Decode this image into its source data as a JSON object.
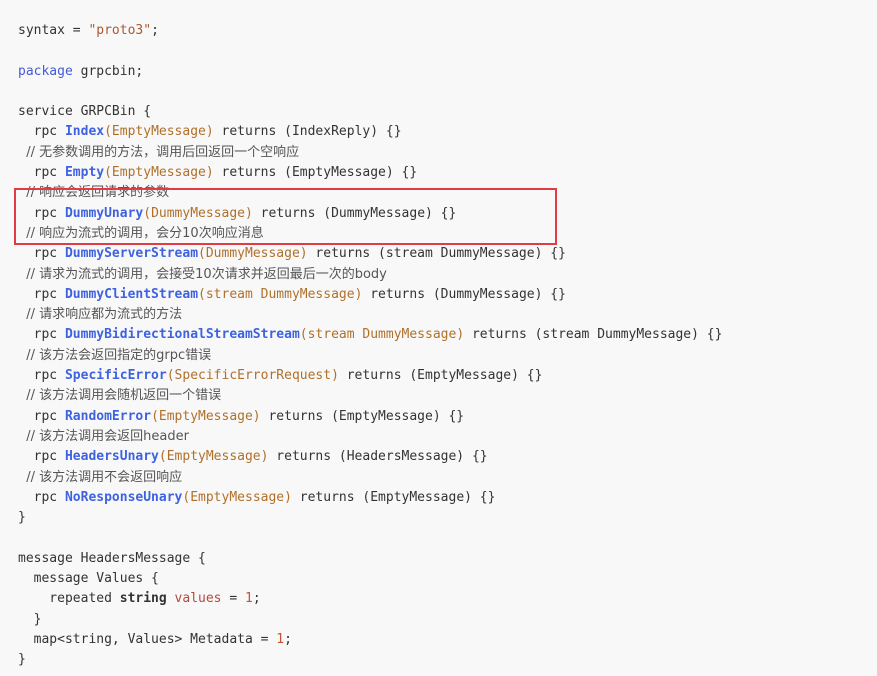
{
  "code": {
    "lines": [
      {
        "tokens": [
          {
            "t": "syntax = ",
            "c": "kw"
          },
          {
            "t": "\"proto3\"",
            "c": "str"
          },
          {
            "t": ";",
            "c": "kw"
          }
        ]
      },
      {
        "tokens": []
      },
      {
        "tokens": [
          {
            "t": "package",
            "c": "kw2"
          },
          {
            "t": " grpcbin;",
            "c": "kw"
          }
        ]
      },
      {
        "tokens": []
      },
      {
        "tokens": [
          {
            "t": "service GRPCBin {",
            "c": "kw"
          }
        ]
      },
      {
        "tokens": [
          {
            "t": "  rpc ",
            "c": "kw"
          },
          {
            "t": "Index",
            "c": "fn"
          },
          {
            "t": "(EmptyMessage)",
            "c": "type"
          },
          {
            "t": " returns (IndexReply) {}",
            "c": "kw"
          }
        ]
      },
      {
        "tokens": [
          {
            "t": "  // 无参数调用的方法，调用后回返回一个空响应",
            "c": "cm"
          }
        ]
      },
      {
        "tokens": [
          {
            "t": "  rpc ",
            "c": "kw"
          },
          {
            "t": "Empty",
            "c": "fn"
          },
          {
            "t": "(EmptyMessage)",
            "c": "type"
          },
          {
            "t": " returns (EmptyMessage) {}",
            "c": "kw"
          }
        ]
      },
      {
        "tokens": [
          {
            "t": "  // 响应会返回请求的参数",
            "c": "cm"
          }
        ]
      },
      {
        "tokens": [
          {
            "t": "  rpc ",
            "c": "kw"
          },
          {
            "t": "DummyUnary",
            "c": "fn"
          },
          {
            "t": "(DummyMessage)",
            "c": "type"
          },
          {
            "t": " returns (DummyMessage) {}",
            "c": "kw"
          }
        ]
      },
      {
        "tokens": [
          {
            "t": "  // 响应为流式的调用，会分10次响应消息",
            "c": "cm"
          }
        ]
      },
      {
        "tokens": [
          {
            "t": "  rpc ",
            "c": "kw"
          },
          {
            "t": "DummyServerStream",
            "c": "fn"
          },
          {
            "t": "(DummyMessage)",
            "c": "type"
          },
          {
            "t": " returns (stream DummyMessage) {}",
            "c": "kw"
          }
        ]
      },
      {
        "tokens": [
          {
            "t": "  // 请求为流式的调用，会接受10次请求并返回最后一次的body",
            "c": "cm"
          }
        ]
      },
      {
        "tokens": [
          {
            "t": "  rpc ",
            "c": "kw"
          },
          {
            "t": "DummyClientStream",
            "c": "fn"
          },
          {
            "t": "(stream DummyMessage)",
            "c": "type"
          },
          {
            "t": " returns (DummyMessage) {}",
            "c": "kw"
          }
        ]
      },
      {
        "tokens": [
          {
            "t": "  // 请求响应都为流式的方法",
            "c": "cm"
          }
        ]
      },
      {
        "tokens": [
          {
            "t": "  rpc ",
            "c": "kw"
          },
          {
            "t": "DummyBidirectionalStreamStream",
            "c": "fn"
          },
          {
            "t": "(stream DummyMessage)",
            "c": "type"
          },
          {
            "t": " returns (stream DummyMessage) {}",
            "c": "kw"
          }
        ]
      },
      {
        "tokens": [
          {
            "t": "  // 该方法会返回指定的grpc错误",
            "c": "cm"
          }
        ]
      },
      {
        "tokens": [
          {
            "t": "  rpc ",
            "c": "kw"
          },
          {
            "t": "SpecificError",
            "c": "fn"
          },
          {
            "t": "(SpecificErrorRequest)",
            "c": "type"
          },
          {
            "t": " returns (EmptyMessage) {}",
            "c": "kw"
          }
        ]
      },
      {
        "tokens": [
          {
            "t": "  // 该方法调用会随机返回一个错误",
            "c": "cm"
          }
        ]
      },
      {
        "tokens": [
          {
            "t": "  rpc ",
            "c": "kw"
          },
          {
            "t": "RandomError",
            "c": "fn"
          },
          {
            "t": "(EmptyMessage)",
            "c": "type"
          },
          {
            "t": " returns (EmptyMessage) {}",
            "c": "kw"
          }
        ]
      },
      {
        "tokens": [
          {
            "t": "  // 该方法调用会返回header",
            "c": "cm"
          }
        ]
      },
      {
        "tokens": [
          {
            "t": "  rpc ",
            "c": "kw"
          },
          {
            "t": "HeadersUnary",
            "c": "fn"
          },
          {
            "t": "(EmptyMessage)",
            "c": "type"
          },
          {
            "t": " returns (HeadersMessage) {}",
            "c": "kw"
          }
        ]
      },
      {
        "tokens": [
          {
            "t": "  // 该方法调用不会返回响应",
            "c": "cm"
          }
        ]
      },
      {
        "tokens": [
          {
            "t": "  rpc ",
            "c": "kw"
          },
          {
            "t": "NoResponseUnary",
            "c": "fn"
          },
          {
            "t": "(EmptyMessage)",
            "c": "type"
          },
          {
            "t": " returns (EmptyMessage) {}",
            "c": "kw"
          }
        ]
      },
      {
        "tokens": [
          {
            "t": "}",
            "c": "kw"
          }
        ]
      },
      {
        "tokens": []
      },
      {
        "tokens": [
          {
            "t": "message HeadersMessage {",
            "c": "kw"
          }
        ]
      },
      {
        "tokens": [
          {
            "t": "  message Values {",
            "c": "kw"
          }
        ]
      },
      {
        "tokens": [
          {
            "t": "    repeated ",
            "c": "kw"
          },
          {
            "t": "string",
            "c": "bold"
          },
          {
            "t": " ",
            "c": "kw"
          },
          {
            "t": "values",
            "c": "var"
          },
          {
            "t": " = ",
            "c": "kw"
          },
          {
            "t": "1",
            "c": "num"
          },
          {
            "t": ";",
            "c": "kw"
          }
        ]
      },
      {
        "tokens": [
          {
            "t": "  }",
            "c": "kw"
          }
        ]
      },
      {
        "tokens": [
          {
            "t": "  map<string, Values> Metadata = ",
            "c": "kw"
          },
          {
            "t": "1",
            "c": "num"
          },
          {
            "t": ";",
            "c": "kw"
          }
        ]
      },
      {
        "tokens": [
          {
            "t": "}",
            "c": "kw"
          }
        ]
      }
    ]
  },
  "colors": {
    "background": "#f8f8f8",
    "highlight_border": "#e33b44"
  }
}
